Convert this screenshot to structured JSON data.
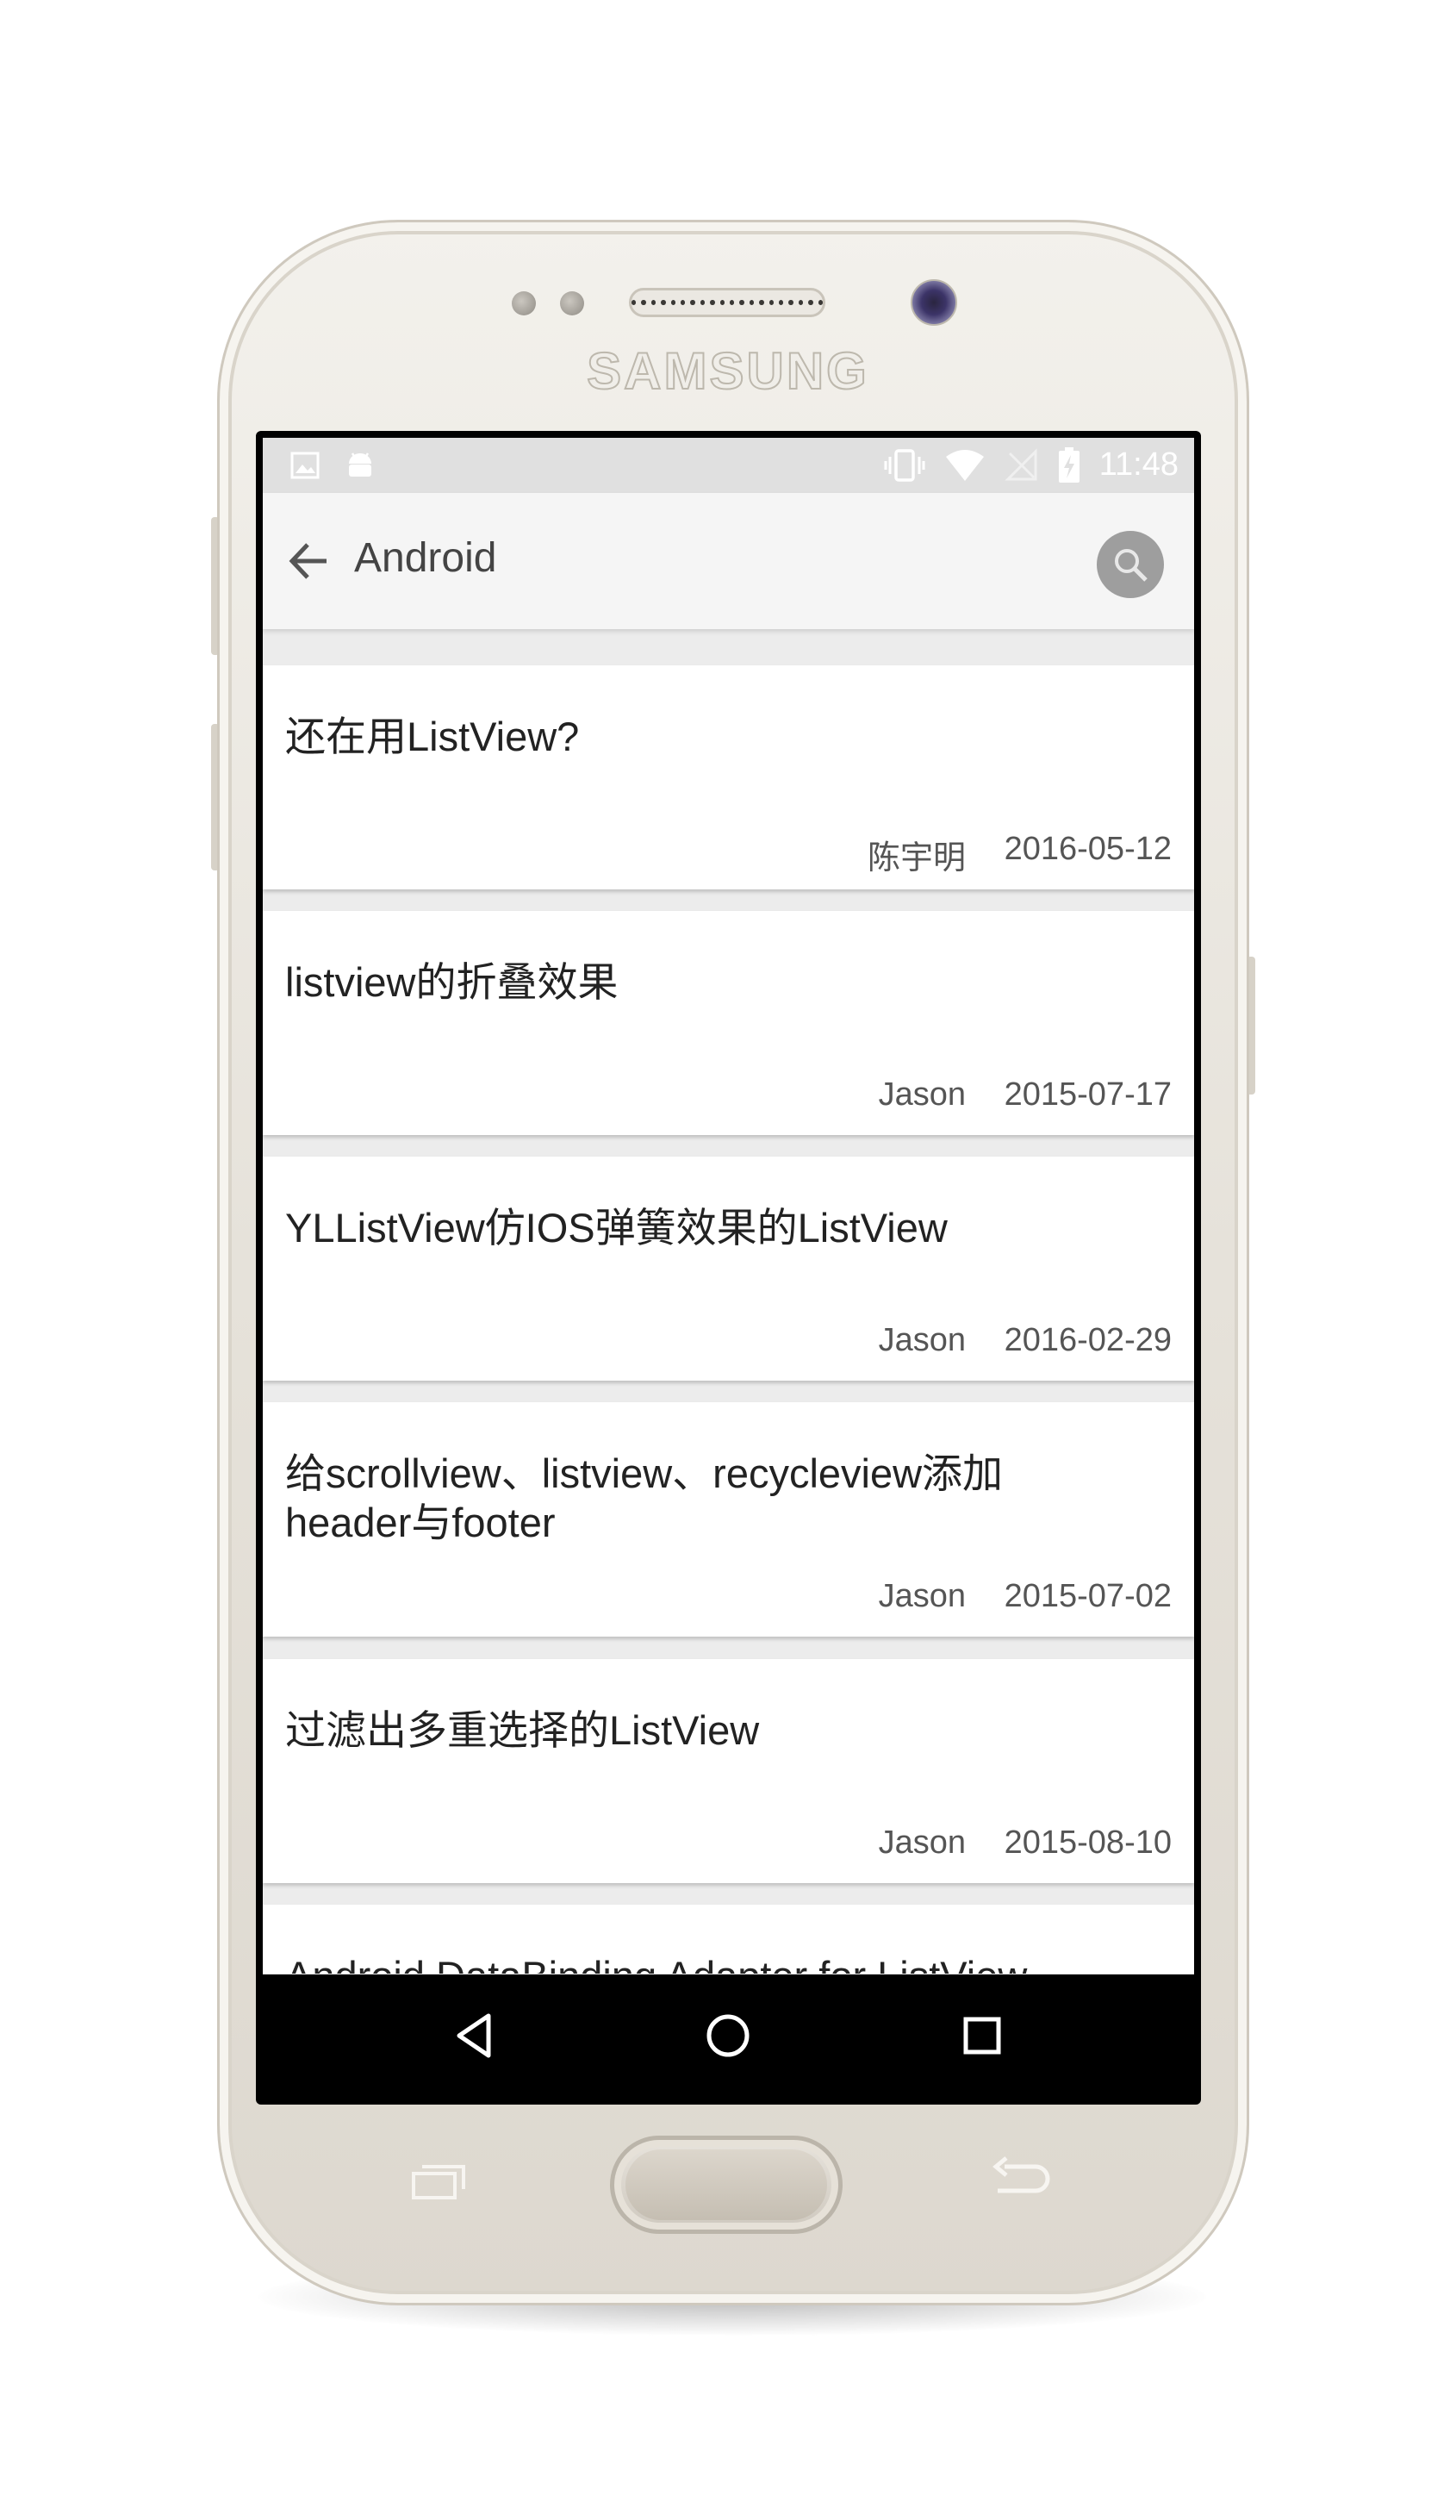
{
  "device": {
    "brand": "SAMSUNG"
  },
  "status_bar": {
    "time": "11:48",
    "left_icons": [
      "image-notification-icon",
      "android-notification-icon"
    ],
    "right_icons": [
      "vibrate-icon",
      "wifi-icon",
      "no-signal-icon",
      "battery-charging-icon"
    ]
  },
  "app_bar": {
    "title": "Android",
    "back_icon": "arrow-left-icon",
    "search_icon": "search-icon"
  },
  "articles": [
    {
      "title": "还在用ListView?",
      "author": "陈宇明",
      "date": "2016-05-12"
    },
    {
      "title": "listview的折叠效果",
      "author": "Jason",
      "date": "2015-07-17"
    },
    {
      "title": "YLListView仿IOS弹簧效果的ListView",
      "author": "Jason",
      "date": "2016-02-29"
    },
    {
      "title": "给scrollview、listview、recycleview添加header与footer",
      "author": "Jason",
      "date": "2015-07-02"
    },
    {
      "title": "过滤出多重选择的ListView",
      "author": "Jason",
      "date": "2015-08-10"
    },
    {
      "title": "Android DataBinding Adapter for ListView",
      "author": "",
      "date": ""
    }
  ],
  "nav_bar": {
    "icons": [
      "back-triangle-icon",
      "home-circle-icon",
      "recents-square-icon"
    ]
  },
  "colors": {
    "status_bar": "#e0e0e0",
    "app_bar": "#f5f5f5",
    "list_background": "#ececec",
    "card": "#ffffff",
    "search_button": "#9e9e9e",
    "nav_bar": "#000000"
  }
}
